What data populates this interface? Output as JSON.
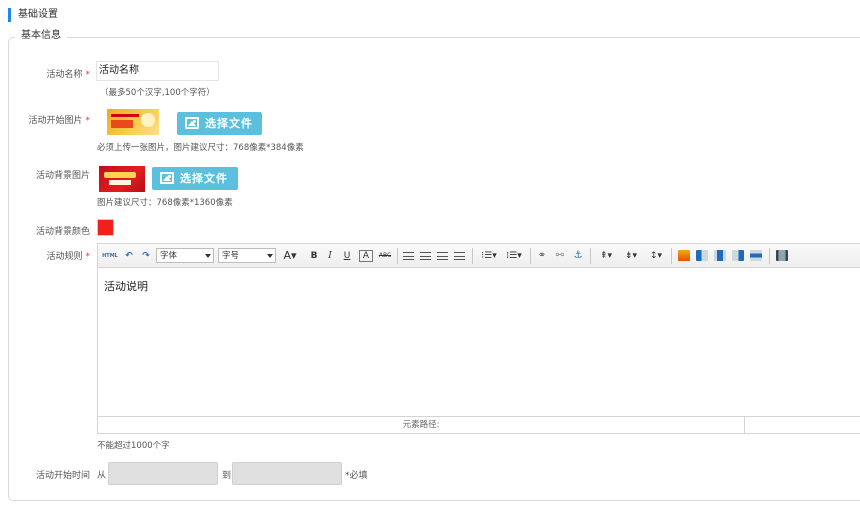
{
  "section_title": "基础设置",
  "legend": "基本信息",
  "required_mark": "*",
  "fields": {
    "activity_name": {
      "label": "活动名称",
      "value": "活动名称",
      "hint": "（最多50个汉字,100个字符）"
    },
    "start_image": {
      "label": "活动开始图片",
      "button": "选择文件",
      "hint": "必须上传一张图片，图片建议尺寸：768像素*384像素"
    },
    "bg_image": {
      "label": "活动背景图片",
      "button": "选择文件",
      "hint": "图片建议尺寸：768像素*1360像素"
    },
    "bg_color": {
      "label": "活动背景颜色",
      "color": "#f0201c"
    },
    "rules": {
      "label": "活动规则",
      "font_select": "字体",
      "size_select": "字号",
      "html_btn": "HTML",
      "content": "活动说明",
      "status_path": "元素路径:",
      "hint": "不能超过1000个字"
    },
    "start_time": {
      "label": "活动开始时间",
      "from": "从",
      "to": "到",
      "required_note": "*必填"
    }
  },
  "colors": {
    "accent": "#1e88e5",
    "button": "#5bc0de",
    "required": "#e53935"
  }
}
